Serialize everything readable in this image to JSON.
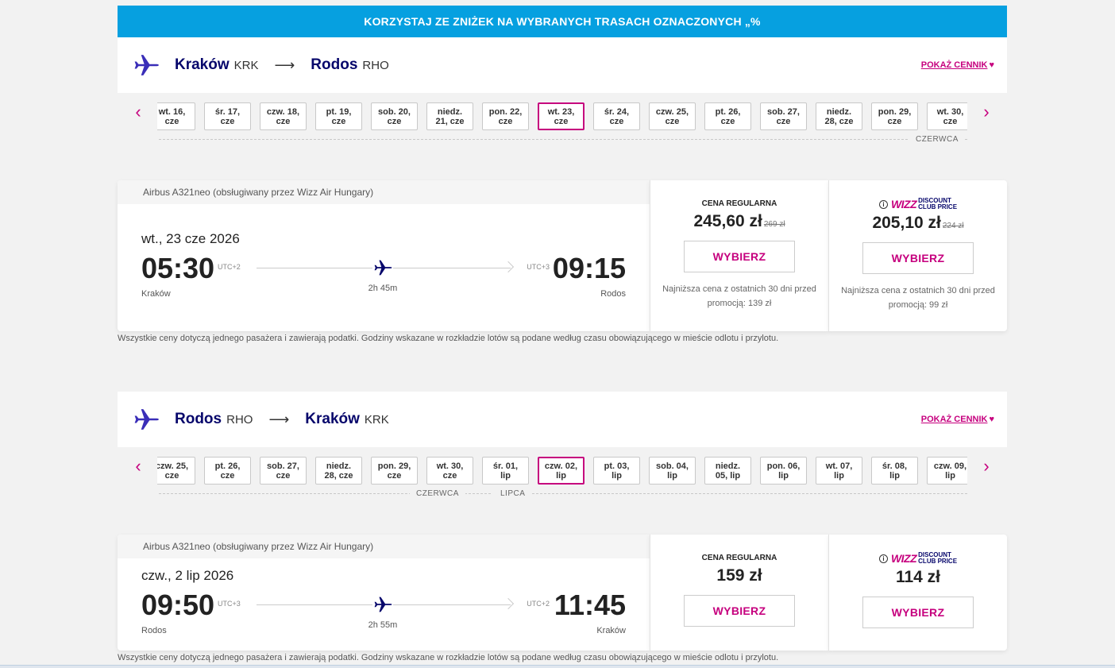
{
  "promo_banner": "KORZYSTAJ ZE ZNIŻEK NA WYBRANYCH TRASACH OZNACZONYCH „%",
  "outbound": {
    "from_city": "Kraków",
    "from_code": "KRK",
    "arrow": "⟶",
    "to_city": "Rodos",
    "to_code": "RHO",
    "price_link": "POKAŻ CENNIK",
    "dates": [
      {
        "day": "wt. 16,",
        "month": "cze"
      },
      {
        "day": "śr. 17,",
        "month": "cze"
      },
      {
        "day": "czw. 18,",
        "month": "cze"
      },
      {
        "day": "pt. 19,",
        "month": "cze"
      },
      {
        "day": "sob. 20,",
        "month": "cze"
      },
      {
        "day": "niedz.",
        "month": "21, cze"
      },
      {
        "day": "pon. 22,",
        "month": "cze"
      },
      {
        "day": "wt. 23,",
        "month": "cze",
        "active": true
      },
      {
        "day": "śr. 24,",
        "month": "cze"
      },
      {
        "day": "czw. 25,",
        "month": "cze"
      },
      {
        "day": "pt. 26,",
        "month": "cze"
      },
      {
        "day": "sob. 27,",
        "month": "cze"
      },
      {
        "day": "niedz.",
        "month": "28, cze"
      },
      {
        "day": "pon. 29,",
        "month": "cze"
      },
      {
        "day": "wt. 30,",
        "month": "cze"
      }
    ],
    "month_labels": [
      "CZERWCA"
    ],
    "aircraft": "Airbus A321neo (obsługiwany przez Wizz Air Hungary)",
    "flight_date": "wt., 23 cze 2026",
    "dep_time": "05:30",
    "dep_utc": "UTC+2",
    "arr_time": "09:15",
    "arr_utc": "UTC+3",
    "duration": "2h 45m",
    "dep_city": "Kraków",
    "arr_city": "Rodos",
    "regular_label": "CENA REGULARNA",
    "regular_price": "245,60 zł",
    "regular_old": "269 zł",
    "regular_select": "WYBIERZ",
    "regular_note": "Najniższa cena z ostatnich 30 dni przed promocją: 139 zł",
    "club_logo_wizz": "WIZZ",
    "club_logo_text1": "DISCOUNT",
    "club_logo_text2": "CLUB PRICE",
    "club_price": "205,10 zł",
    "club_old": "224 zł",
    "club_select": "WYBIERZ",
    "club_note": "Najniższa cena z ostatnich 30 dni przed promocją: 99 zł",
    "disclaimer": "Wszystkie ceny dotyczą jednego pasażera i zawierają podatki. Godziny wskazane w rozkładzie lotów są podane według czasu obowiązującego w mieście odlotu i przylotu."
  },
  "inbound": {
    "from_city": "Rodos",
    "from_code": "RHO",
    "arrow": "⟶",
    "to_city": "Kraków",
    "to_code": "KRK",
    "price_link": "POKAŻ CENNIK",
    "dates": [
      {
        "day": "czw. 25,",
        "month": "cze"
      },
      {
        "day": "pt. 26,",
        "month": "cze"
      },
      {
        "day": "sob. 27,",
        "month": "cze"
      },
      {
        "day": "niedz.",
        "month": "28, cze"
      },
      {
        "day": "pon. 29,",
        "month": "cze"
      },
      {
        "day": "wt. 30,",
        "month": "cze"
      },
      {
        "day": "śr. 01,",
        "month": "lip"
      },
      {
        "day": "czw. 02,",
        "month": "lip",
        "active": true
      },
      {
        "day": "pt. 03,",
        "month": "lip"
      },
      {
        "day": "sob. 04,",
        "month": "lip"
      },
      {
        "day": "niedz.",
        "month": "05, lip"
      },
      {
        "day": "pon. 06,",
        "month": "lip"
      },
      {
        "day": "wt. 07,",
        "month": "lip"
      },
      {
        "day": "śr. 08,",
        "month": "lip"
      },
      {
        "day": "czw. 09,",
        "month": "lip"
      }
    ],
    "month_labels": [
      "CZERWCA",
      "LIPCA"
    ],
    "aircraft": "Airbus A321neo (obsługiwany przez Wizz Air Hungary)",
    "flight_date": "czw., 2 lip 2026",
    "dep_time": "09:50",
    "dep_utc": "UTC+3",
    "arr_time": "11:45",
    "arr_utc": "UTC+2",
    "duration": "2h 55m",
    "dep_city": "Rodos",
    "arr_city": "Kraków",
    "regular_label": "CENA REGULARNA",
    "regular_price": "159 zł",
    "regular_select": "WYBIERZ",
    "club_logo_wizz": "WIZZ",
    "club_logo_text1": "DISCOUNT",
    "club_logo_text2": "CLUB PRICE",
    "club_price": "114 zł",
    "club_select": "WYBIERZ",
    "disclaimer": "Wszystkie ceny dotyczą jednego pasażera i zawierają podatki. Godziny wskazane w rozkładzie lotów są podane według czasu obowiązującego w mieście odlotu i przylotu."
  },
  "colors": {
    "accent": "#c6007e",
    "navy": "#06066b",
    "banner": "#06a0e0"
  }
}
